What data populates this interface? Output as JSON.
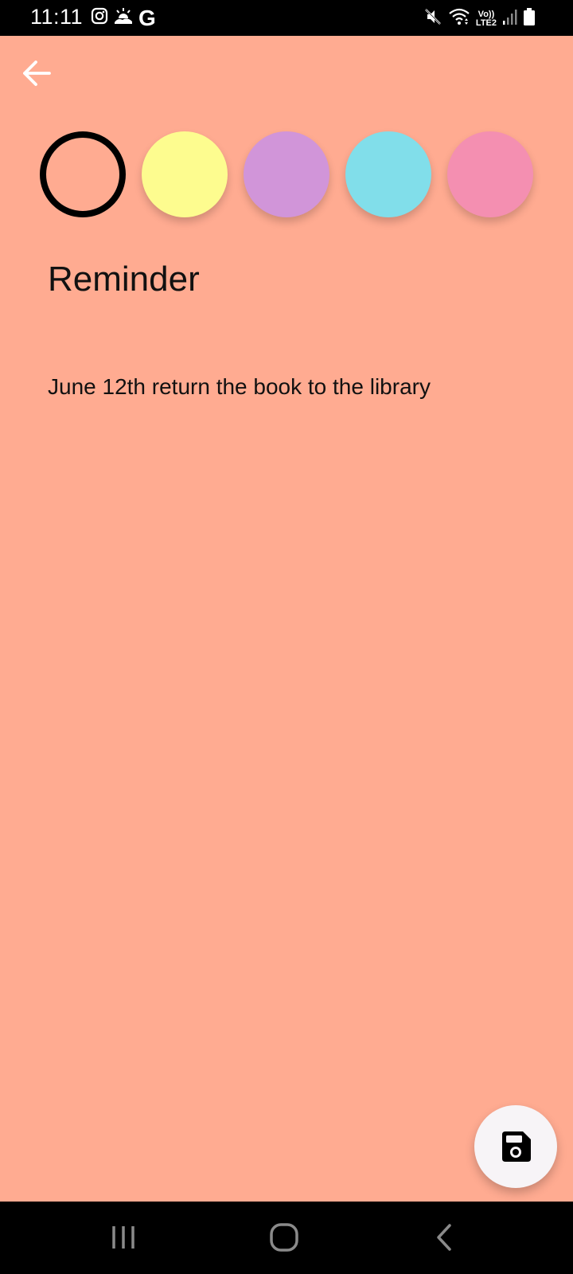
{
  "status_bar": {
    "time": "11:11",
    "left_icons": [
      "instagram-icon",
      "weather-icon",
      "google-icon"
    ],
    "google_letter": "G",
    "right_icons": [
      "mute-icon",
      "wifi-icon",
      "volte-icon",
      "signal-icon",
      "battery-icon"
    ],
    "volte_top": "Vo))",
    "volte_bottom": "LTE2"
  },
  "colors": {
    "background": "#FFAB91",
    "swatches": [
      "#FFAB91",
      "#FDFC8F",
      "#D195D9",
      "#81DEEA",
      "#F48FB1"
    ],
    "selected_index": 0
  },
  "note": {
    "title": "Reminder",
    "body": "June 12th return the book to the library"
  },
  "fab": {
    "icon": "save-icon"
  },
  "nav_bar": {
    "icons": [
      "recent-apps-icon",
      "home-icon",
      "back-nav-icon"
    ]
  }
}
